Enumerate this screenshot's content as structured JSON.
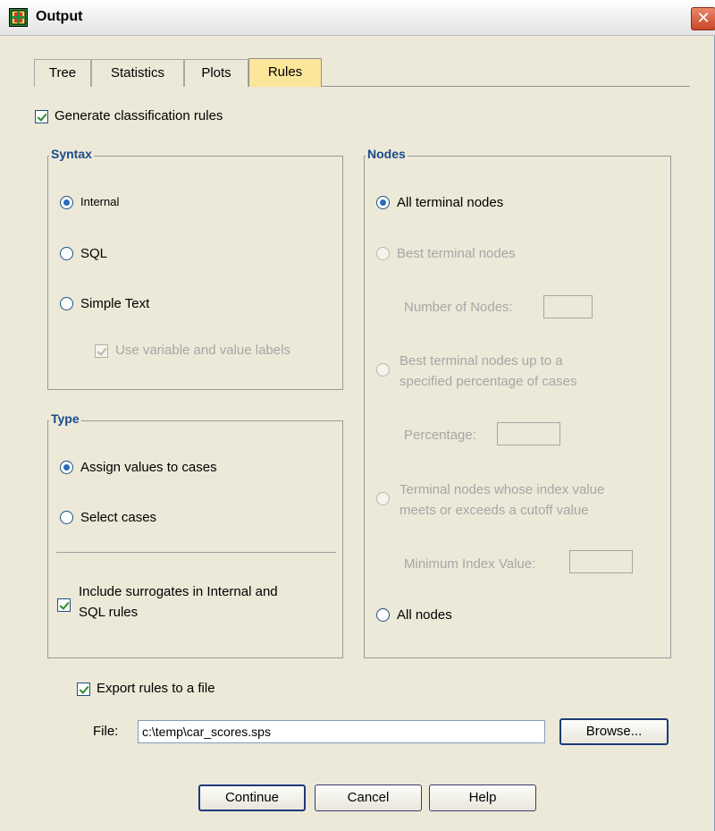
{
  "window": {
    "title": "Output",
    "close_glyph": "✕"
  },
  "tabs": [
    {
      "label": "Tree",
      "active": false
    },
    {
      "label": "Statistics",
      "active": false
    },
    {
      "label": "Plots",
      "active": false
    },
    {
      "label": "Rules",
      "active": true
    }
  ],
  "generate_rules": {
    "label": "Generate classification rules",
    "checked": true
  },
  "syntax": {
    "title": "Syntax",
    "options": [
      {
        "label": "Internal",
        "selected": true
      },
      {
        "label": "SQL",
        "selected": false
      },
      {
        "label": "Simple Text",
        "selected": false
      }
    ],
    "use_labels": {
      "label": "Use variable and value labels",
      "checked": true,
      "enabled": false
    }
  },
  "type": {
    "title": "Type",
    "options": [
      {
        "label": "Assign values to cases",
        "selected": true
      },
      {
        "label": "Select cases",
        "selected": false
      }
    ],
    "surrogates": {
      "label_line1": "Include surrogates in Internal and",
      "label_line2": "SQL rules",
      "checked": true
    }
  },
  "nodes": {
    "title": "Nodes",
    "all_terminal": {
      "label": "All terminal nodes",
      "selected": true
    },
    "best_terminal": {
      "label": "Best terminal nodes",
      "selected": false,
      "enabled": false
    },
    "number_of_nodes": {
      "label": "Number of Nodes:",
      "value": ""
    },
    "best_percent": {
      "label_line1": "Best terminal nodes up to a",
      "label_line2": "specified percentage of cases",
      "enabled": false
    },
    "percentage": {
      "label": "Percentage:",
      "value": ""
    },
    "index_cutoff": {
      "label_line1": "Terminal nodes whose index value",
      "label_line2": "meets or exceeds a cutoff value",
      "enabled": false
    },
    "min_index": {
      "label": "Minimum Index Value:",
      "value": ""
    },
    "all_nodes": {
      "label": "All nodes",
      "selected": false
    }
  },
  "export": {
    "label": "Export rules to a file",
    "checked": true,
    "file_label": "File:",
    "file_value": "c:\\temp\\car_scores.sps",
    "browse_label": "Browse..."
  },
  "buttons": {
    "continue": "Continue",
    "cancel": "Cancel",
    "help": "Help"
  }
}
